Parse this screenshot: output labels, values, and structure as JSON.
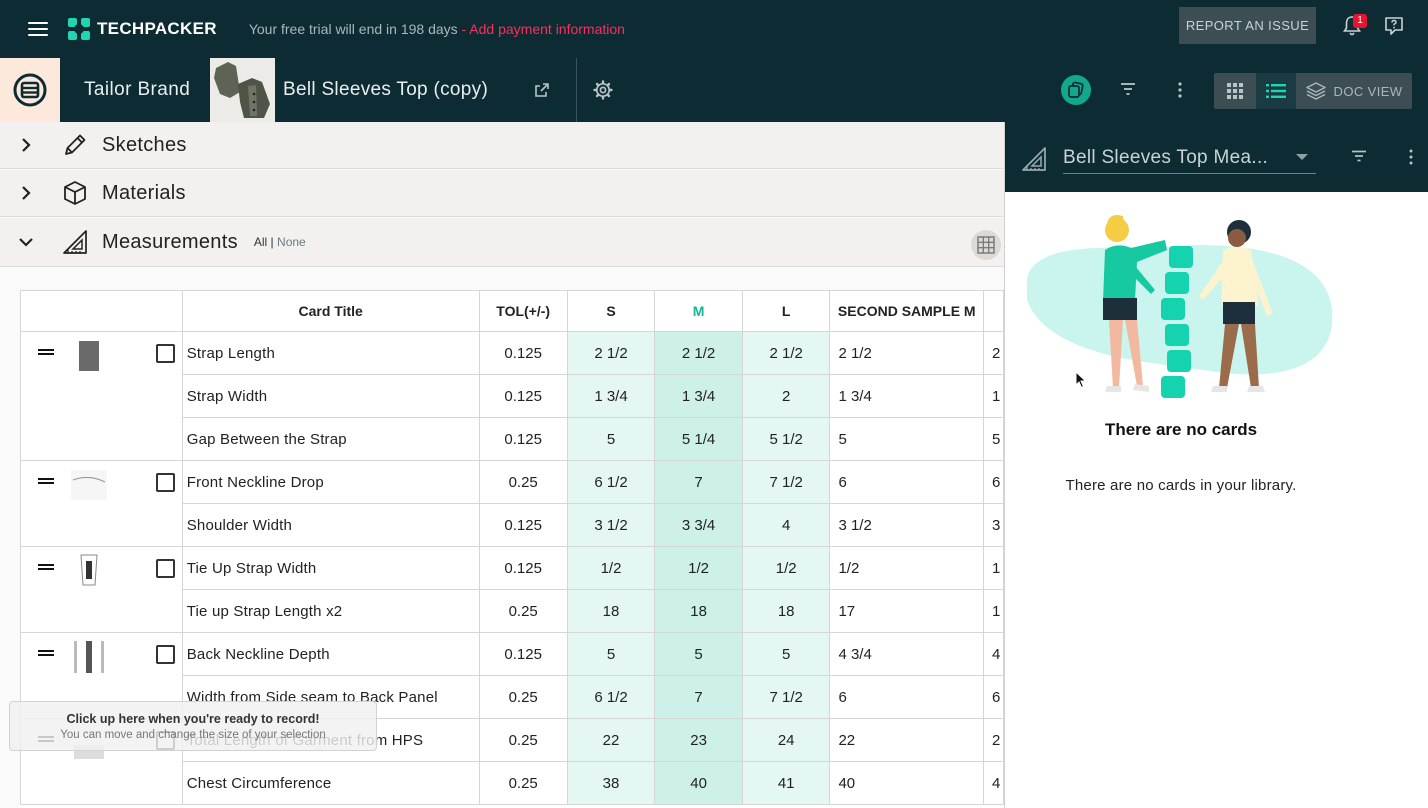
{
  "topbar": {
    "logo_text": "TECHPACKER",
    "trial_text": "Your free trial will end in 198 days",
    "trial_link": " - Add payment information",
    "report_label": "REPORT AN ISSUE",
    "notification_count": "1"
  },
  "header": {
    "brand_name": "Tailor Brand",
    "style_name": "Bell Sleeves Top (copy)",
    "doc_view_label": "DOC VIEW"
  },
  "sections": {
    "sketches": "Sketches",
    "materials": "Materials",
    "measurements": "Measurements",
    "all_label": "All |",
    "none_label": "None"
  },
  "table": {
    "headers": [
      "Card Title",
      "TOL(+/-)",
      "S",
      "M",
      "L",
      "SECOND SAMPLE M"
    ],
    "rows": [
      {
        "title": "Strap Length",
        "tol": "0.125",
        "s": "2 1/2",
        "m": "2 1/2",
        "l": "2 1/2",
        "second": "2 1/2",
        "extra": "2"
      },
      {
        "title": "Strap Width",
        "tol": "0.125",
        "s": "1 3/4",
        "m": "1 3/4",
        "l": "2",
        "second": "1 3/4",
        "extra": "1"
      },
      {
        "title": "Gap Between the Strap",
        "tol": "0.125",
        "s": "5",
        "m": "5 1/4",
        "l": "5 1/2",
        "second": "5",
        "extra": "5"
      },
      {
        "title": "Front Neckline Drop",
        "tol": "0.25",
        "s": "6 1/2",
        "m": "7",
        "l": "7 1/2",
        "second": "6",
        "extra": "6"
      },
      {
        "title": "Shoulder Width",
        "tol": "0.125",
        "s": "3 1/2",
        "m": "3 3/4",
        "l": "4",
        "second": "3 1/2",
        "extra": "3"
      },
      {
        "title": "Tie Up Strap Width",
        "tol": "0.125",
        "s": "1/2",
        "m": "1/2",
        "l": "1/2",
        "second": "1/2",
        "extra": "1"
      },
      {
        "title": "Tie up Strap Length x2",
        "tol": "0.25",
        "s": "18",
        "m": "18",
        "l": "18",
        "second": "17",
        "extra": "1"
      },
      {
        "title": "Back Neckline Depth",
        "tol": "0.125",
        "s": "5",
        "m": "5",
        "l": "5",
        "second": "4 3/4",
        "extra": "4"
      },
      {
        "title": "Width from Side seam to Back Panel",
        "tol": "0.25",
        "s": "6 1/2",
        "m": "7",
        "l": "7 1/2",
        "second": "6",
        "extra": "6"
      },
      {
        "title": "Total Length of Garment from HPS",
        "tol": "0.25",
        "s": "22",
        "m": "23",
        "l": "24",
        "second": "22",
        "extra": "2"
      },
      {
        "title": "Chest Circumference",
        "tol": "0.25",
        "s": "38",
        "m": "40",
        "l": "41",
        "second": "40",
        "extra": "4"
      }
    ]
  },
  "panel": {
    "select_value": "Bell Sleeves Top Mea...",
    "empty_title": "There are no cards",
    "empty_desc": "There are no cards in your library."
  },
  "recorder": {
    "title": "Click up here when you're ready to record!",
    "subtitle": "You can move and change the size of your selection"
  },
  "colors": {
    "topbar_bg": "#0d2b33",
    "accent": "#20d6b2",
    "size_highlight": "#cdf1e9",
    "size_light": "#e4f7f3",
    "alert_red": "#ff2d5a"
  }
}
